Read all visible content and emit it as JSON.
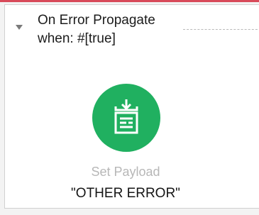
{
  "scope": {
    "title": "On Error Propagate",
    "condition": "when: #[true]"
  },
  "component": {
    "icon": "set-payload-icon",
    "name": "Set Payload",
    "value": "\"OTHER ERROR\""
  },
  "colors": {
    "accent_top_line": "#d84a5a",
    "component_green": "#20b060"
  }
}
